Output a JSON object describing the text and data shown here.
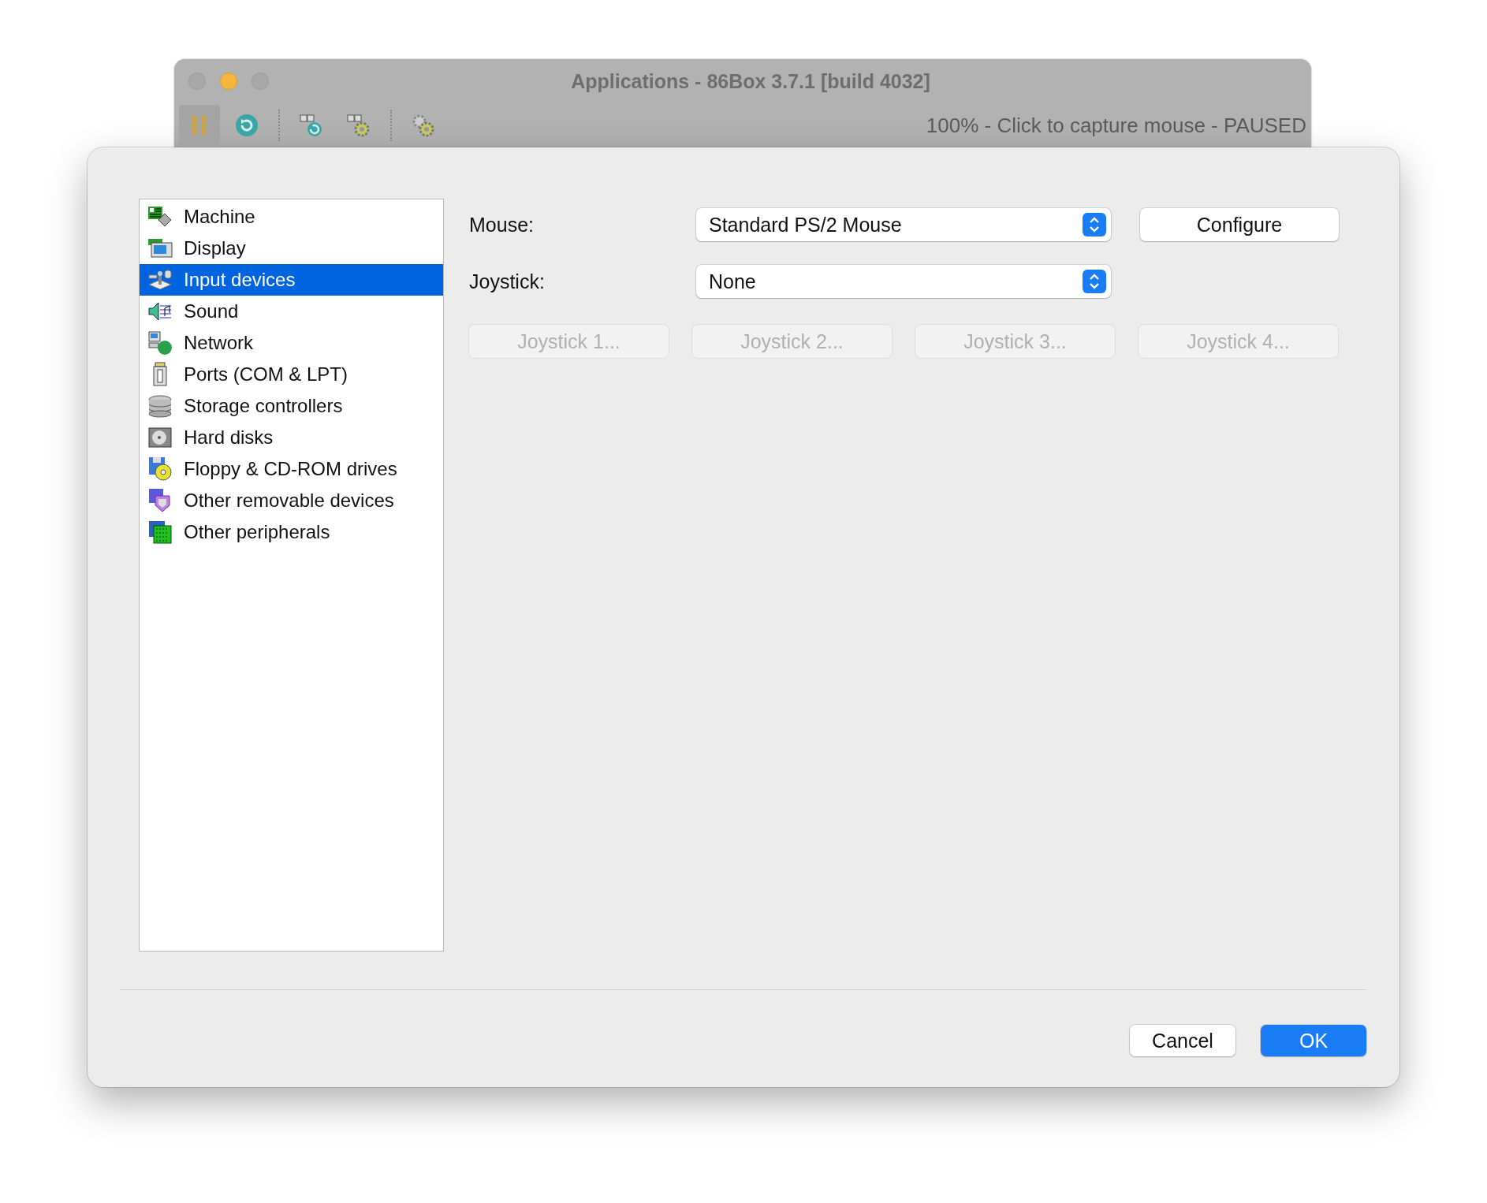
{
  "parent_window": {
    "title": "Applications - 86Box 3.7.1 [build 4032]",
    "status": "100% - Click to capture mouse - PAUSED",
    "toolbar": [
      {
        "kind": "pause",
        "pressed": true
      },
      {
        "kind": "reset",
        "pressed": false
      },
      {
        "kind": "separator"
      },
      {
        "kind": "ctrl-alt-del",
        "pressed": false
      },
      {
        "kind": "ctrl-alt-esc",
        "pressed": false
      },
      {
        "kind": "separator"
      },
      {
        "kind": "settings",
        "pressed": false
      }
    ]
  },
  "sidebar": {
    "items": [
      {
        "label": "Machine",
        "kind": "machine",
        "selected": false
      },
      {
        "label": "Display",
        "kind": "display",
        "selected": false
      },
      {
        "label": "Input devices",
        "kind": "input",
        "selected": true
      },
      {
        "label": "Sound",
        "kind": "sound",
        "selected": false
      },
      {
        "label": "Network",
        "kind": "network",
        "selected": false
      },
      {
        "label": "Ports (COM & LPT)",
        "kind": "ports",
        "selected": false
      },
      {
        "label": "Storage controllers",
        "kind": "storage",
        "selected": false
      },
      {
        "label": "Hard disks",
        "kind": "hdd",
        "selected": false
      },
      {
        "label": "Floppy & CD-ROM drives",
        "kind": "floppy",
        "selected": false
      },
      {
        "label": "Other removable devices",
        "kind": "removable",
        "selected": false
      },
      {
        "label": "Other peripherals",
        "kind": "peripherals",
        "selected": false
      }
    ]
  },
  "fields": [
    {
      "label": "Mouse:",
      "value": "Standard PS/2 Mouse",
      "button": {
        "label": "Configure",
        "disabled": false
      }
    },
    {
      "label": "Joystick:",
      "value": "None"
    }
  ],
  "joystick_buttons": [
    {
      "label": "Joystick 1...",
      "disabled": true
    },
    {
      "label": "Joystick 2...",
      "disabled": true
    },
    {
      "label": "Joystick 3...",
      "disabled": true
    },
    {
      "label": "Joystick 4...",
      "disabled": true
    }
  ],
  "buttons": [
    {
      "label": "Cancel",
      "default": false
    },
    {
      "label": "OK",
      "default": true
    }
  ]
}
